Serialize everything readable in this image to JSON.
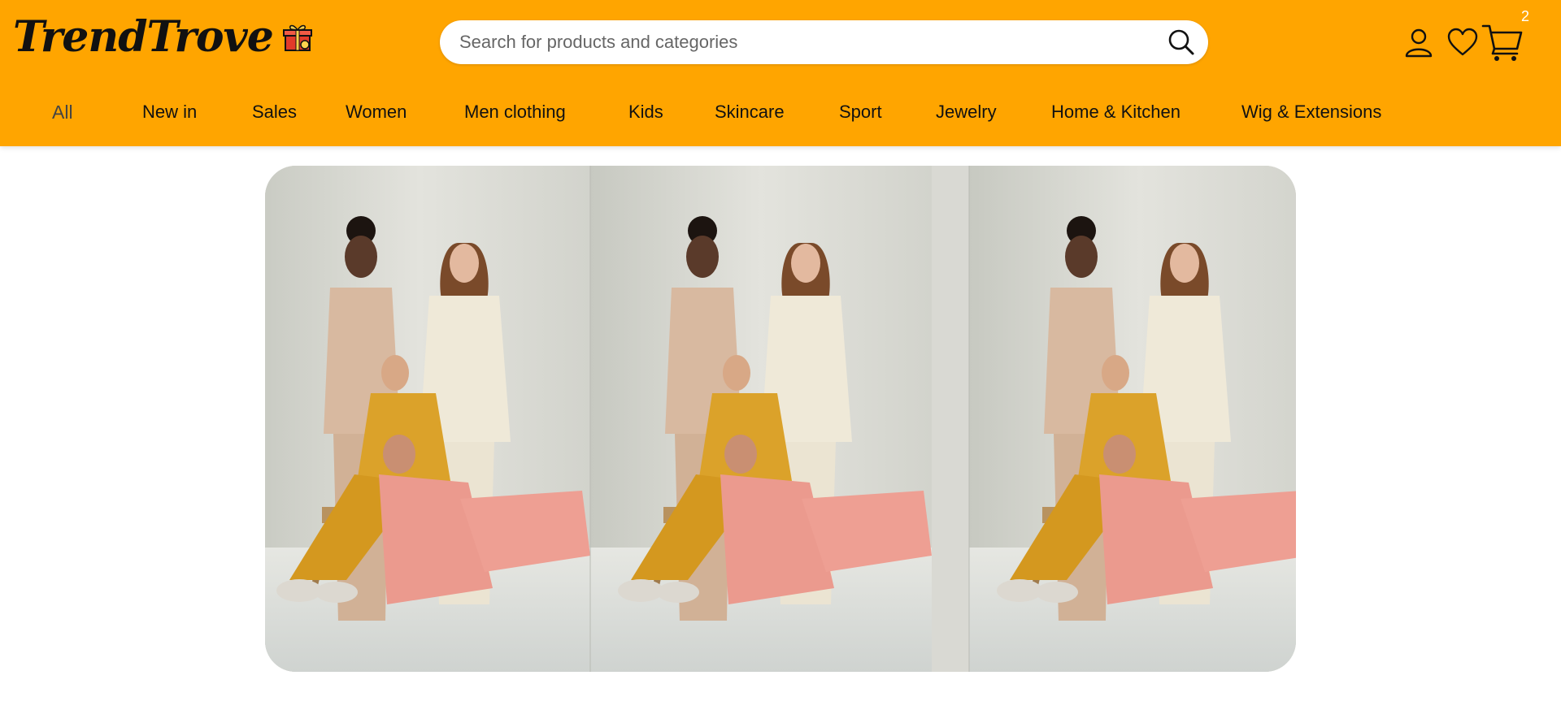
{
  "brand": {
    "name": "TrendTrove",
    "logo_icon": "gift-icon"
  },
  "search": {
    "placeholder": "Search for products and categories",
    "value": "",
    "icon": "search-icon"
  },
  "header_icons": {
    "account": "user-icon",
    "wishlist": "heart-icon",
    "cart": "cart-icon",
    "cart_count": "2"
  },
  "nav": {
    "items": [
      {
        "label": "All"
      },
      {
        "label": "New in"
      },
      {
        "label": "Sales"
      },
      {
        "label": "Women"
      },
      {
        "label": "Men clothing"
      },
      {
        "label": "Kids"
      },
      {
        "label": "Skincare"
      },
      {
        "label": "Sport"
      },
      {
        "label": "Jewelry"
      },
      {
        "label": "Home & Kitchen"
      },
      {
        "label": "Wig & Extensions"
      }
    ]
  },
  "colors": {
    "header_bg": "#FFA500",
    "banner_bg": "#d9d9d3",
    "suit_beige": "#d8b9a0",
    "suit_cream": "#efe9d8",
    "suit_mustard": "#dba22a",
    "suit_pink": "#eb9a8e"
  },
  "banner": {
    "image": "hero-banner-image",
    "panel_count": 3
  }
}
